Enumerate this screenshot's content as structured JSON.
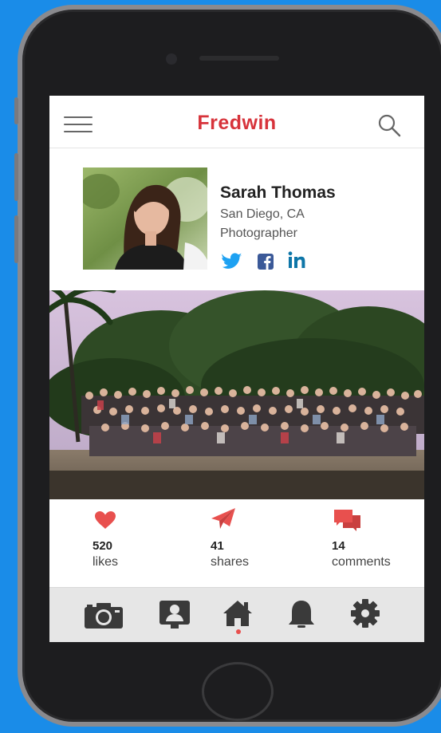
{
  "app": {
    "title": "Fredwin"
  },
  "profile": {
    "name": "Sarah Thomas",
    "location": "San Diego, CA",
    "occupation": "Photographer",
    "socials": [
      "twitter-icon",
      "facebook-icon",
      "linkedin-icon"
    ]
  },
  "stats": [
    {
      "icon": "heart-icon",
      "count": "520",
      "label": "likes"
    },
    {
      "icon": "paper-plane-icon",
      "count": "41",
      "label": "shares"
    },
    {
      "icon": "chat-bubbles-icon",
      "count": "14",
      "label": "comments"
    }
  ],
  "tabbar": {
    "tabs": [
      "camera-icon",
      "contact-icon",
      "home-icon",
      "bell-icon",
      "gear-icon"
    ],
    "active": "home-icon"
  },
  "colors": {
    "brand": "#d7333b",
    "accent": "#e8504e",
    "twitter": "#1da1f2",
    "facebook": "#3b5998",
    "linkedin": "#0e76a8",
    "tab_icon": "#3a3a3a",
    "background": "#1a8ce8"
  }
}
